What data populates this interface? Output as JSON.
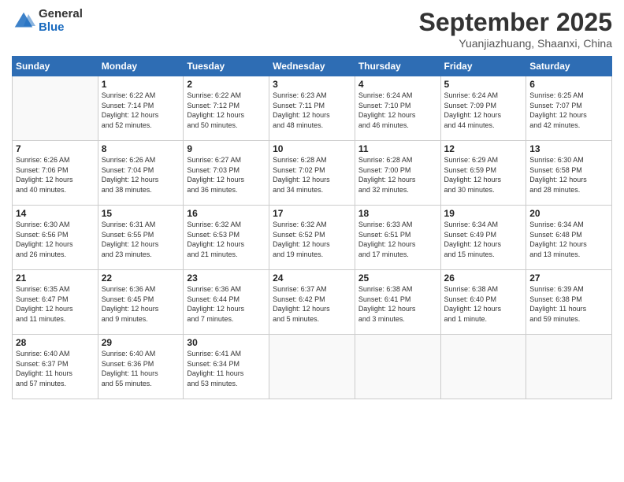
{
  "logo": {
    "general": "General",
    "blue": "Blue"
  },
  "header": {
    "month": "September 2025",
    "location": "Yuanjiazhuang, Shaanxi, China"
  },
  "days_of_week": [
    "Sunday",
    "Monday",
    "Tuesday",
    "Wednesday",
    "Thursday",
    "Friday",
    "Saturday"
  ],
  "weeks": [
    [
      {
        "num": "",
        "info": ""
      },
      {
        "num": "1",
        "info": "Sunrise: 6:22 AM\nSunset: 7:14 PM\nDaylight: 12 hours\nand 52 minutes."
      },
      {
        "num": "2",
        "info": "Sunrise: 6:22 AM\nSunset: 7:12 PM\nDaylight: 12 hours\nand 50 minutes."
      },
      {
        "num": "3",
        "info": "Sunrise: 6:23 AM\nSunset: 7:11 PM\nDaylight: 12 hours\nand 48 minutes."
      },
      {
        "num": "4",
        "info": "Sunrise: 6:24 AM\nSunset: 7:10 PM\nDaylight: 12 hours\nand 46 minutes."
      },
      {
        "num": "5",
        "info": "Sunrise: 6:24 AM\nSunset: 7:09 PM\nDaylight: 12 hours\nand 44 minutes."
      },
      {
        "num": "6",
        "info": "Sunrise: 6:25 AM\nSunset: 7:07 PM\nDaylight: 12 hours\nand 42 minutes."
      }
    ],
    [
      {
        "num": "7",
        "info": "Sunrise: 6:26 AM\nSunset: 7:06 PM\nDaylight: 12 hours\nand 40 minutes."
      },
      {
        "num": "8",
        "info": "Sunrise: 6:26 AM\nSunset: 7:04 PM\nDaylight: 12 hours\nand 38 minutes."
      },
      {
        "num": "9",
        "info": "Sunrise: 6:27 AM\nSunset: 7:03 PM\nDaylight: 12 hours\nand 36 minutes."
      },
      {
        "num": "10",
        "info": "Sunrise: 6:28 AM\nSunset: 7:02 PM\nDaylight: 12 hours\nand 34 minutes."
      },
      {
        "num": "11",
        "info": "Sunrise: 6:28 AM\nSunset: 7:00 PM\nDaylight: 12 hours\nand 32 minutes."
      },
      {
        "num": "12",
        "info": "Sunrise: 6:29 AM\nSunset: 6:59 PM\nDaylight: 12 hours\nand 30 minutes."
      },
      {
        "num": "13",
        "info": "Sunrise: 6:30 AM\nSunset: 6:58 PM\nDaylight: 12 hours\nand 28 minutes."
      }
    ],
    [
      {
        "num": "14",
        "info": "Sunrise: 6:30 AM\nSunset: 6:56 PM\nDaylight: 12 hours\nand 26 minutes."
      },
      {
        "num": "15",
        "info": "Sunrise: 6:31 AM\nSunset: 6:55 PM\nDaylight: 12 hours\nand 23 minutes."
      },
      {
        "num": "16",
        "info": "Sunrise: 6:32 AM\nSunset: 6:53 PM\nDaylight: 12 hours\nand 21 minutes."
      },
      {
        "num": "17",
        "info": "Sunrise: 6:32 AM\nSunset: 6:52 PM\nDaylight: 12 hours\nand 19 minutes."
      },
      {
        "num": "18",
        "info": "Sunrise: 6:33 AM\nSunset: 6:51 PM\nDaylight: 12 hours\nand 17 minutes."
      },
      {
        "num": "19",
        "info": "Sunrise: 6:34 AM\nSunset: 6:49 PM\nDaylight: 12 hours\nand 15 minutes."
      },
      {
        "num": "20",
        "info": "Sunrise: 6:34 AM\nSunset: 6:48 PM\nDaylight: 12 hours\nand 13 minutes."
      }
    ],
    [
      {
        "num": "21",
        "info": "Sunrise: 6:35 AM\nSunset: 6:47 PM\nDaylight: 12 hours\nand 11 minutes."
      },
      {
        "num": "22",
        "info": "Sunrise: 6:36 AM\nSunset: 6:45 PM\nDaylight: 12 hours\nand 9 minutes."
      },
      {
        "num": "23",
        "info": "Sunrise: 6:36 AM\nSunset: 6:44 PM\nDaylight: 12 hours\nand 7 minutes."
      },
      {
        "num": "24",
        "info": "Sunrise: 6:37 AM\nSunset: 6:42 PM\nDaylight: 12 hours\nand 5 minutes."
      },
      {
        "num": "25",
        "info": "Sunrise: 6:38 AM\nSunset: 6:41 PM\nDaylight: 12 hours\nand 3 minutes."
      },
      {
        "num": "26",
        "info": "Sunrise: 6:38 AM\nSunset: 6:40 PM\nDaylight: 12 hours\nand 1 minute."
      },
      {
        "num": "27",
        "info": "Sunrise: 6:39 AM\nSunset: 6:38 PM\nDaylight: 11 hours\nand 59 minutes."
      }
    ],
    [
      {
        "num": "28",
        "info": "Sunrise: 6:40 AM\nSunset: 6:37 PM\nDaylight: 11 hours\nand 57 minutes."
      },
      {
        "num": "29",
        "info": "Sunrise: 6:40 AM\nSunset: 6:36 PM\nDaylight: 11 hours\nand 55 minutes."
      },
      {
        "num": "30",
        "info": "Sunrise: 6:41 AM\nSunset: 6:34 PM\nDaylight: 11 hours\nand 53 minutes."
      },
      {
        "num": "",
        "info": ""
      },
      {
        "num": "",
        "info": ""
      },
      {
        "num": "",
        "info": ""
      },
      {
        "num": "",
        "info": ""
      }
    ]
  ]
}
